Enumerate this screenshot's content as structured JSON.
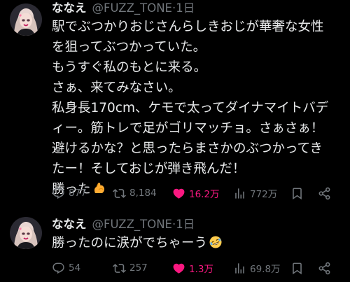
{
  "tweets": [
    {
      "display_name": "ななえ",
      "handle": "@FUZZ_TONE",
      "separator": "·",
      "time": "1日",
      "lines": [
        "駅でぶつかりおじさんらしきおじが華奢な女性",
        "を狙ってぶつかっていた。",
        "もうすぐ私のもとに来る。",
        "さぁ、来てみなさい。",
        "私身長170cm、ケモで太ってダイナマイトバデ",
        "ィー。筋トレで足がゴリマッチョ。さぁさぁ！",
        "避けるかな？と思ったらまさかのぶつかってき",
        "たー！そしておじが弾き飛んだ！",
        "勝った"
      ],
      "trailing_emoji": "flexed-biceps",
      "actions": {
        "replies": "877",
        "retweets": "8,184",
        "likes": "16.2万",
        "views": "772万"
      },
      "liked": true
    },
    {
      "display_name": "ななえ",
      "handle": "@FUZZ_TONE",
      "separator": "·",
      "time": "1日",
      "lines": [
        "勝ったのに涙がでちゃーう"
      ],
      "trailing_emoji": "rolling-on-the-floor-laughing",
      "actions": {
        "replies": "54",
        "retweets": "257",
        "likes": "1.3万",
        "views": "69.8万"
      },
      "liked": true
    }
  ],
  "colors": {
    "background": "#000000",
    "text": "#e7e9ea",
    "muted": "#71767b",
    "like": "#f91880"
  }
}
